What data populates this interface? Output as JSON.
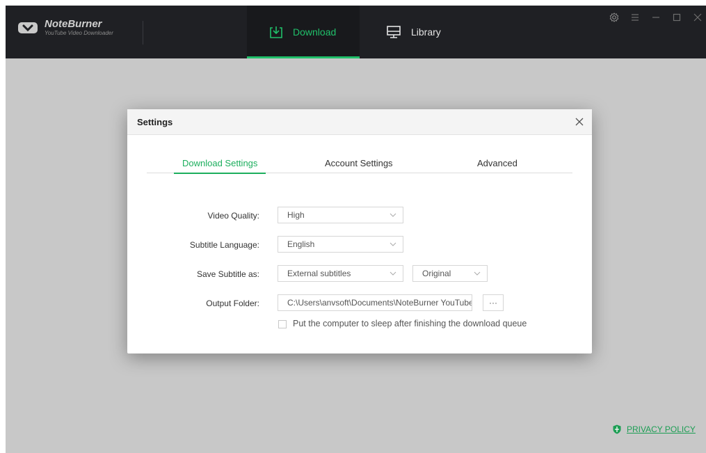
{
  "app": {
    "name": "NoteBurner",
    "subtitle": "YouTube Video Downloader"
  },
  "nav": {
    "download_label": "Download",
    "library_label": "Library"
  },
  "dialog": {
    "title": "Settings",
    "tabs": [
      "Download Settings",
      "Account Settings",
      "Advanced"
    ],
    "active_tab": "Download Settings",
    "fields": {
      "video_quality_label": "Video Quality:",
      "video_quality_value": "High",
      "subtitle_language_label": "Subtitle Language:",
      "subtitle_language_value": "English",
      "save_subtitle_label": "Save Subtitle as:",
      "save_subtitle_value": "External subtitles",
      "save_subtitle_lang_value": "Original",
      "output_folder_label": "Output Folder:",
      "output_folder_value": "C:\\Users\\anvsoft\\Documents\\NoteBurner YouTube Video Downloader",
      "browse_label": "···",
      "sleep_label": "Put the computer to sleep after finishing the download queue",
      "sleep_checked": false
    }
  },
  "footer": {
    "privacy_label": "PRIVACY POLICY"
  },
  "colors": {
    "accent": "#20c06a",
    "titlebar": "#1f2024",
    "background": "#c8c8c8"
  },
  "icons": [
    "noteburner-logo-icon",
    "download-icon",
    "library-icon",
    "settings-icon",
    "menu-icon",
    "minimize-icon",
    "maximize-icon",
    "close-icon",
    "chevron-down-icon",
    "shield-icon"
  ]
}
